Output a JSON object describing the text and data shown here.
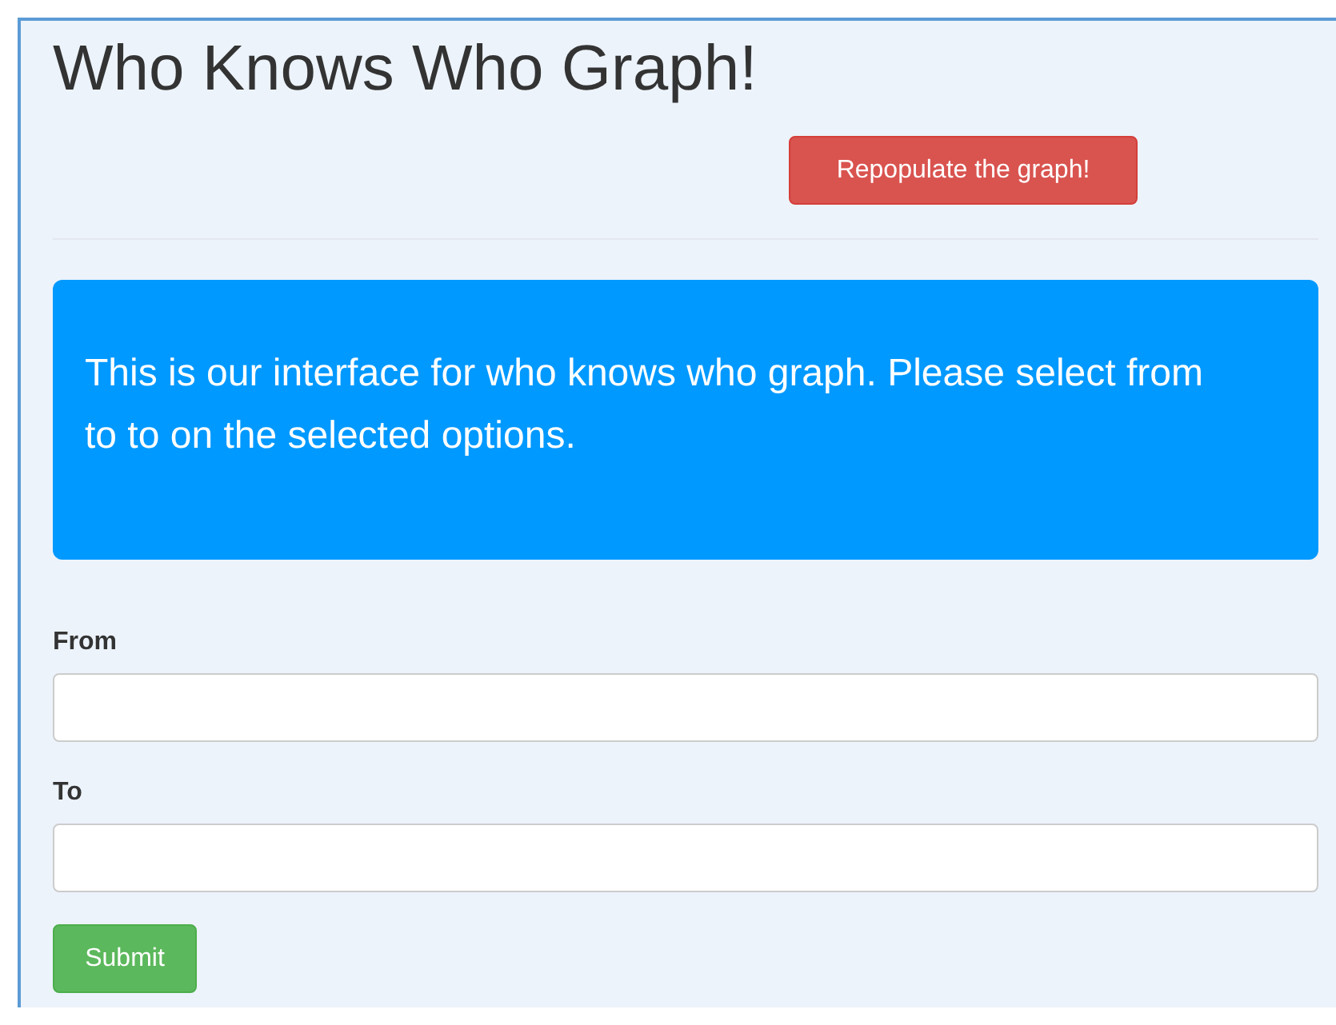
{
  "title": "Who Knows Who Graph!",
  "repopulate_button": "Repopulate the graph!",
  "intro": "This is our interface for who knows who graph. Please select from to to on the selected options.",
  "fields": [
    {
      "label": "From"
    },
    {
      "label": "To"
    }
  ],
  "submit_button": "Submit"
}
